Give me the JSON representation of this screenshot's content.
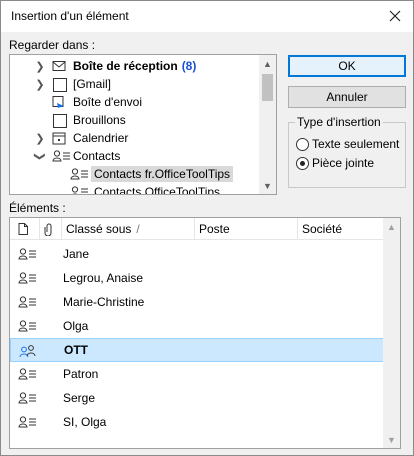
{
  "window": {
    "title": "Insertion d'un élément"
  },
  "look_in": {
    "label": "Regarder dans :",
    "folders": [
      {
        "label": "Boîte de réception",
        "count": "(8)",
        "icon": "envelope-icon",
        "expandable": "collapsed"
      },
      {
        "label": "[Gmail]",
        "icon": "folder-icon",
        "expandable": "collapsed"
      },
      {
        "label": "Boîte d'envoi",
        "icon": "outbox-icon",
        "expandable": "none"
      },
      {
        "label": "Brouillons",
        "icon": "folder-icon",
        "expandable": "none"
      },
      {
        "label": "Calendrier",
        "icon": "calendar-icon",
        "expandable": "collapsed"
      },
      {
        "label": "Contacts",
        "icon": "contact-card-icon",
        "expandable": "expanded"
      },
      {
        "label": "Contacts fr.OfficeToolTips",
        "icon": "contact-card-icon",
        "expandable": "none",
        "selected": true
      },
      {
        "label": "Contacts OfficeToolTips",
        "icon": "contact-card-icon",
        "expandable": "none"
      }
    ]
  },
  "buttons": {
    "ok": "OK",
    "cancel": "Annuler"
  },
  "insert_type": {
    "title": "Type d'insertion",
    "options": [
      {
        "label": "Texte seulement",
        "checked": false
      },
      {
        "label": "Pièce jointe",
        "checked": true
      }
    ]
  },
  "items": {
    "label": "Éléments :",
    "columns": [
      "Classé sous",
      "Poste",
      "Société"
    ],
    "sort_indicator": "/",
    "rows": [
      {
        "name": "Jane",
        "selected": false
      },
      {
        "name": "Legrou, Anaise",
        "selected": false
      },
      {
        "name": "Marie-Christine",
        "selected": false
      },
      {
        "name": "Olga",
        "selected": false
      },
      {
        "name": "OTT",
        "selected": true
      },
      {
        "name": "Patron",
        "selected": false
      },
      {
        "name": "Serge",
        "selected": false
      },
      {
        "name": "SI, Olga",
        "selected": false
      }
    ]
  },
  "colors": {
    "accent": "#0078d7",
    "selection": "#cce8ff",
    "count": "#1a4fd6"
  }
}
